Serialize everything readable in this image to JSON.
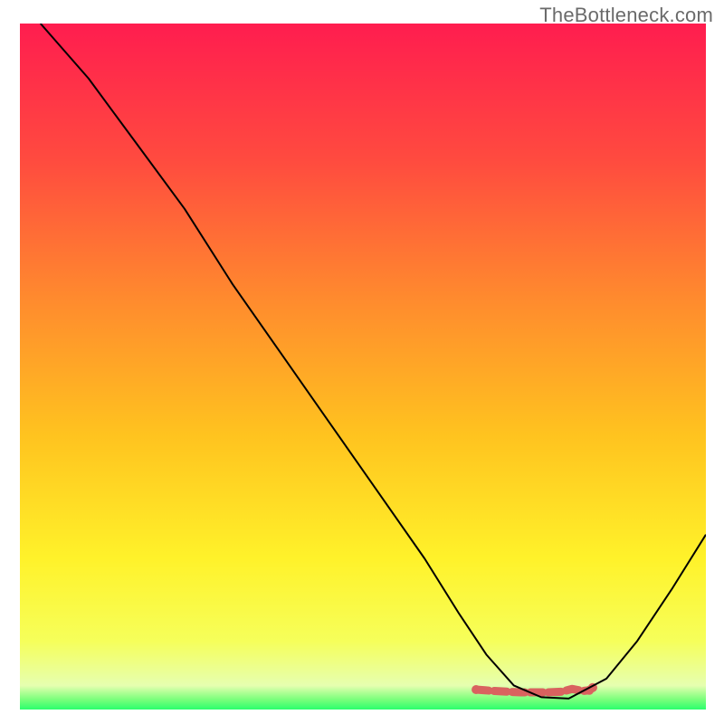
{
  "attribution": "TheBottleneck.com",
  "chart_data": {
    "type": "line",
    "title": "",
    "xlabel": "",
    "ylabel": "",
    "xlim": [
      0,
      100
    ],
    "ylim": [
      0,
      100
    ],
    "background_gradient_stops": [
      {
        "offset": 0.0,
        "color": "#ff1d4f"
      },
      {
        "offset": 0.2,
        "color": "#ff4b3f"
      },
      {
        "offset": 0.4,
        "color": "#ff8a2e"
      },
      {
        "offset": 0.6,
        "color": "#ffc31f"
      },
      {
        "offset": 0.78,
        "color": "#fff22a"
      },
      {
        "offset": 0.9,
        "color": "#f6ff5a"
      },
      {
        "offset": 0.965,
        "color": "#e6ffb0"
      },
      {
        "offset": 0.985,
        "color": "#7cff7c"
      },
      {
        "offset": 1.0,
        "color": "#2bff6d"
      }
    ],
    "series": [
      {
        "name": "bottleneck-curve",
        "color": "#000000",
        "stroke_width": 2.0,
        "x": [
          3.0,
          10.0,
          17.0,
          24.0,
          31.0,
          38.0,
          45.0,
          52.0,
          59.0,
          64.0,
          68.0,
          72.0,
          76.0,
          80.0,
          85.5,
          90.0,
          95.0,
          100.0
        ],
        "y": [
          100.0,
          92.0,
          82.5,
          73.0,
          62.0,
          52.0,
          42.0,
          32.0,
          22.0,
          14.0,
          8.0,
          3.5,
          1.8,
          1.6,
          4.5,
          10.0,
          17.5,
          25.5
        ]
      },
      {
        "name": "marker-band",
        "color": "#d9625f",
        "stroke_width": 9.0,
        "x": [
          66.5,
          67.8,
          69.2,
          71.0,
          73.0,
          75.0,
          77.0,
          79.0,
          80.5,
          82.0,
          83.0,
          83.5
        ],
        "y": [
          2.9,
          2.8,
          2.7,
          2.6,
          2.5,
          2.5,
          2.5,
          2.6,
          3.0,
          2.7,
          2.8,
          3.2
        ]
      }
    ]
  }
}
